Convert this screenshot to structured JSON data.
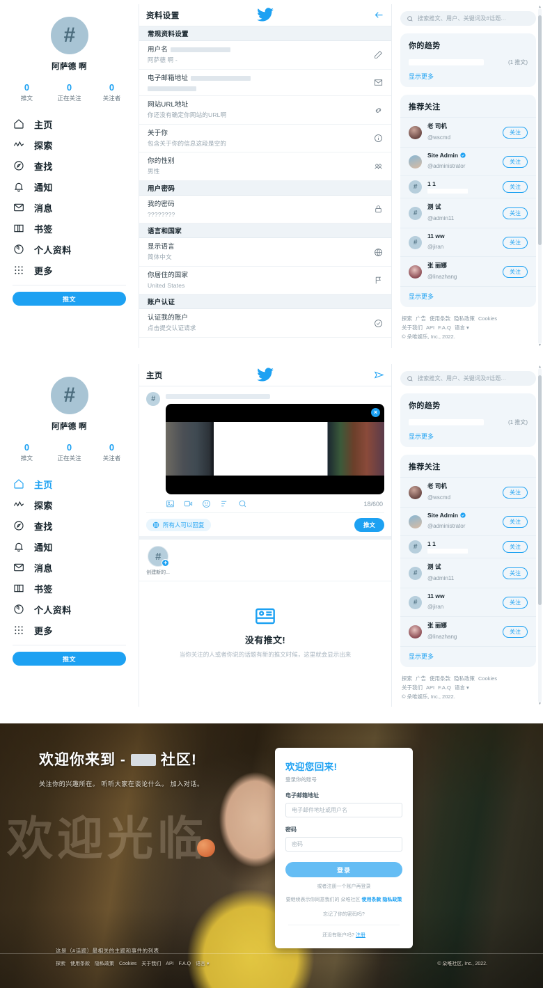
{
  "profile": {
    "avatar_glyph": "#",
    "name": "阿萨德 啊",
    "stats": [
      {
        "num": "0",
        "label": "推文"
      },
      {
        "num": "0",
        "label": "正在关注"
      },
      {
        "num": "0",
        "label": "关注者"
      }
    ]
  },
  "nav": {
    "items": [
      {
        "icon": "home-icon",
        "label": "主页"
      },
      {
        "icon": "explore-icon",
        "label": "探索"
      },
      {
        "icon": "search-compass-icon",
        "label": "查找"
      },
      {
        "icon": "bell-icon",
        "label": "通知"
      },
      {
        "icon": "mail-icon",
        "label": "消息"
      },
      {
        "icon": "bookmark-icon",
        "label": "书签"
      },
      {
        "icon": "profile-icon",
        "label": "个人资料"
      },
      {
        "icon": "more-grid-icon",
        "label": "更多"
      }
    ],
    "tweet_button": "推文"
  },
  "settings": {
    "header_title": "资料设置",
    "back_icon": "arrow-left-icon",
    "sections": [
      {
        "heading": "常规资料设置",
        "rows": [
          {
            "label": "用户名",
            "sub": "阿萨德 啊 -",
            "icon": "pencil-icon",
            "redacted_label": true,
            "redacted_sub": false
          },
          {
            "label": "电子邮箱地址",
            "sub": "",
            "icon": "envelope-icon",
            "redacted_label": true,
            "redacted_sub": true
          },
          {
            "label": "网站URL地址",
            "sub": "你还没有确定你网站的URL啊",
            "icon": "link-icon",
            "redacted_label": false,
            "redacted_sub": false
          },
          {
            "label": "关于你",
            "sub": "包含关于你的信息这段是空的",
            "icon": "info-icon",
            "redacted_label": false,
            "redacted_sub": false
          },
          {
            "label": "你的性别",
            "sub": "男性",
            "icon": "gender-icon",
            "redacted_label": false,
            "redacted_sub": false
          }
        ]
      },
      {
        "heading": "用户密码",
        "rows": [
          {
            "label": "我的密码",
            "sub": "????????",
            "icon": "lock-icon",
            "redacted_label": false,
            "redacted_sub": false
          }
        ]
      },
      {
        "heading": "语言和国家",
        "rows": [
          {
            "label": "显示语言",
            "sub": "简体中文",
            "icon": "globe-icon",
            "redacted_label": false,
            "redacted_sub": false
          },
          {
            "label": "你居住的国家",
            "sub": "United States",
            "icon": "flag-icon",
            "redacted_label": false,
            "redacted_sub": false
          }
        ]
      },
      {
        "heading": "账户认证",
        "rows": [
          {
            "label": "认证我的账户",
            "sub": "点击提交认证请求",
            "icon": "check-circle-icon",
            "redacted_label": false,
            "redacted_sub": false
          }
        ]
      }
    ]
  },
  "home": {
    "header_title": "主页",
    "send_icon": "send-icon",
    "compose": {
      "avatar_glyph": "#",
      "media_close": "×",
      "tools": [
        "image-icon",
        "video-icon",
        "emoji-icon",
        "poll-icon",
        "search-gif-icon"
      ],
      "char_count": "18/600",
      "reply_scope": "所有人可以回复",
      "reply_scope_icon": "globe-icon",
      "post_button": "推文"
    },
    "stories": [
      {
        "glyph": "#",
        "label": "创建新的...",
        "plus": "+"
      }
    ],
    "empty": {
      "icon": "no-tweets-icon",
      "title": "没有推文!",
      "subtitle": "当你关注的人或者你说的话题有新的推文时候，这里就会显示出来"
    }
  },
  "right": {
    "search_placeholder": "搜索推文、用户、关键词及#话题...",
    "search_icon": "search-icon",
    "trends": {
      "title": "你的趋势",
      "items": [
        {
          "name_redacted": true,
          "count": "(1 推文)"
        }
      ],
      "show_more": "显示更多"
    },
    "who_to_follow": {
      "title": "推荐关注",
      "follow_label": "关注",
      "show_more": "显示更多",
      "users": [
        {
          "name": "老 司机",
          "handle": "@wscmd",
          "avatar": "photo",
          "verified": false,
          "handle_redacted": false
        },
        {
          "name": "Site Admin",
          "handle": "@administrator",
          "avatar": "photo",
          "verified": true,
          "handle_redacted": false
        },
        {
          "name": "1 1",
          "handle": "",
          "avatar": "hash",
          "verified": false,
          "handle_redacted": true
        },
        {
          "name": "测 试",
          "handle": "@admin11",
          "avatar": "hash",
          "verified": false,
          "handle_redacted": false
        },
        {
          "name": "11 ww",
          "handle": "@jiran",
          "avatar": "hash",
          "verified": false,
          "handle_redacted": false
        },
        {
          "name": "张 丽娜",
          "handle": "@linazhang",
          "avatar": "photo",
          "verified": false,
          "handle_redacted": false
        }
      ]
    },
    "footer": {
      "line1": [
        "探索",
        "广告",
        "使用条款",
        "隐私政策",
        "Cookies"
      ],
      "line2": [
        "关于我们",
        "API",
        "F.A.Q",
        "语言 ▾"
      ],
      "copyright": "© 朵唯娱乐, Inc., 2022."
    }
  },
  "login": {
    "hero": {
      "title_prefix": "欢迎你来到 -",
      "title_suffix": "社区!",
      "subtitle": "关注你的兴趣所在。 听听大家在谈论什么。 加入对话。",
      "ghost_text": "欢迎光临",
      "bottom_note": "这是（#话题）最相关的主题和事件的列表"
    },
    "card": {
      "title": "欢迎您回来!",
      "subtitle": "登录你的账号",
      "email_label": "电子邮箱地址",
      "email_placeholder": "电子邮件地址或用户名",
      "email_value": "",
      "password_label": "密码",
      "password_placeholder": "密码",
      "password_value": "",
      "submit": "登录",
      "or_register": "或者注册一个账户再登录",
      "terms_prefix": "要继续表示你同意我们的 朵唯社区",
      "terms_link": "使用条款",
      "privacy_link": "隐私政策",
      "forgot": "忘记了你的密码吗?",
      "signup_prefix": "还没有账户吗?",
      "signup_link": "注册"
    },
    "footer": {
      "links": [
        "探索",
        "使用条款",
        "隐私政策",
        "Cookies",
        "关于我们",
        "API",
        "F.A.Q",
        "语言 ▾"
      ],
      "copyright": "© 朵唯社区, Inc., 2022."
    }
  },
  "colors": {
    "accent": "#1da1f2",
    "section_bg": "#eef3f7",
    "card_bg": "#f1f6fa",
    "text": "#17242c",
    "muted": "#8a99a4"
  }
}
